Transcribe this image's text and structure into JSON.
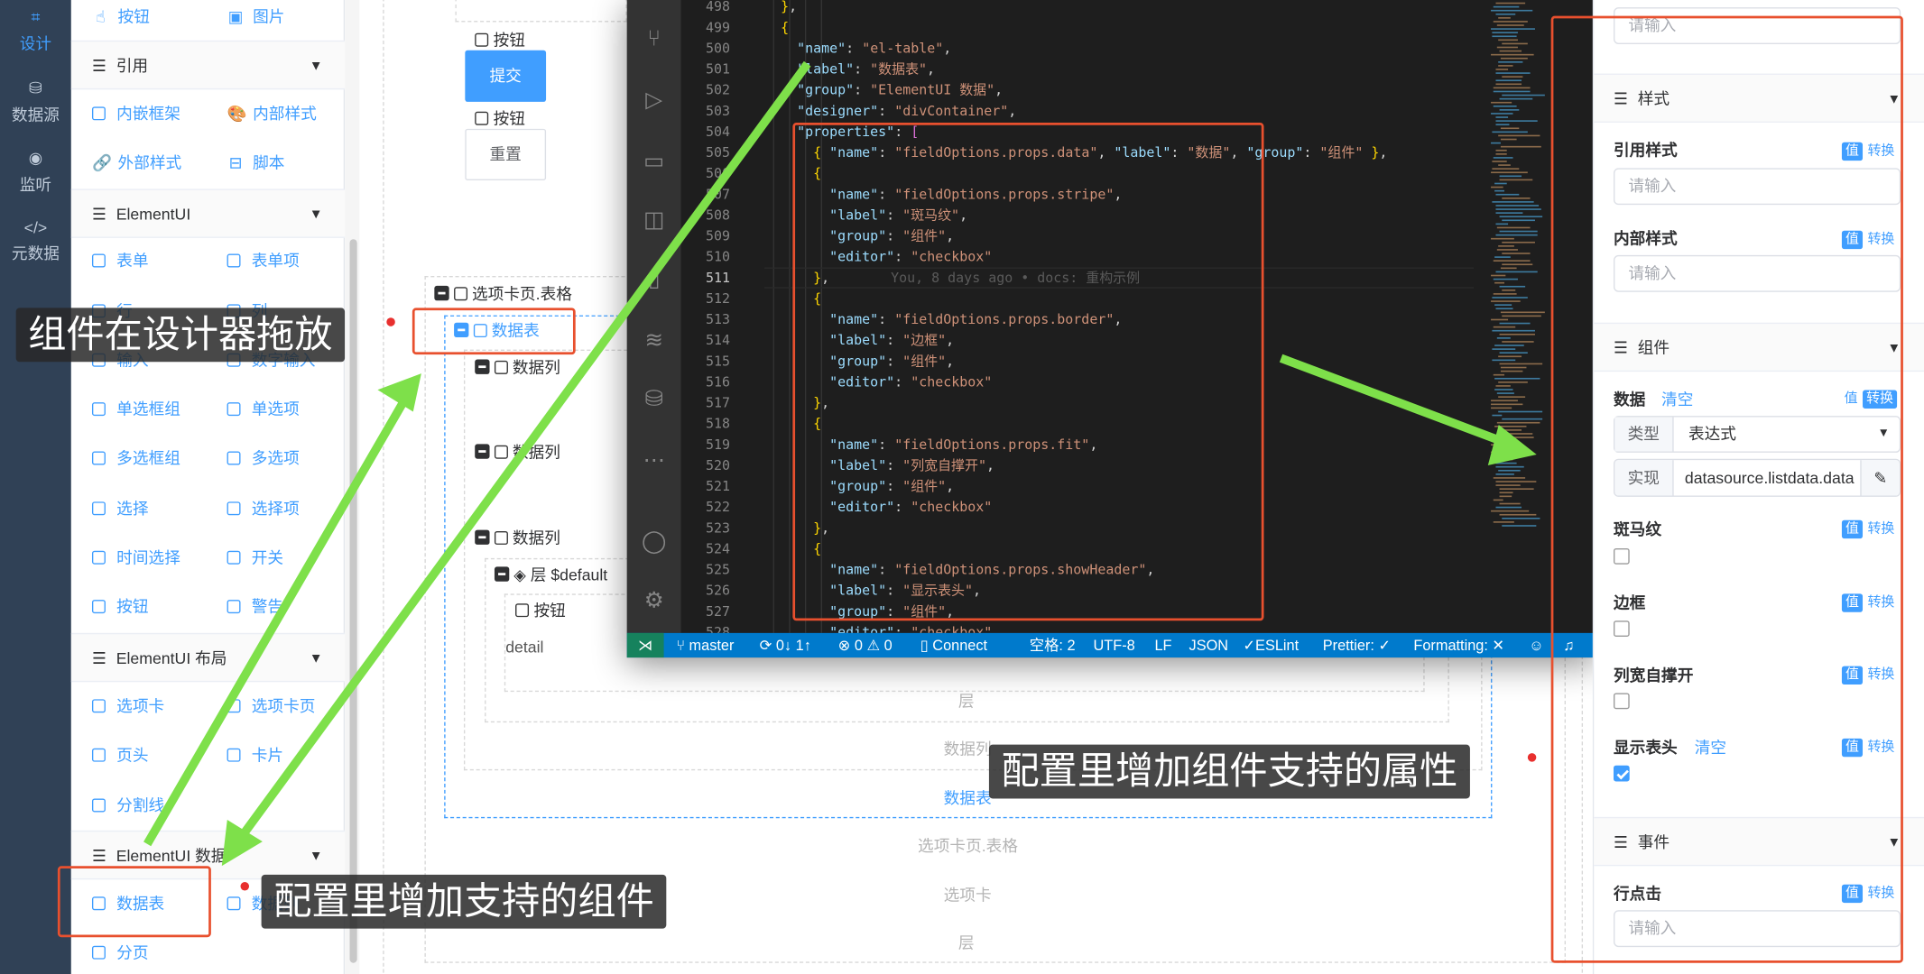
{
  "nav": {
    "items": [
      {
        "label": "设计",
        "icon": "design-icon",
        "glyph": "⌗",
        "active": true
      },
      {
        "label": "数据源",
        "icon": "database-icon",
        "glyph": "⛁",
        "active": false
      },
      {
        "label": "监听",
        "icon": "listen-icon",
        "glyph": "◉",
        "active": false
      },
      {
        "label": "元数据",
        "icon": "code-icon",
        "glyph": "</>",
        "active": false
      }
    ]
  },
  "palette": {
    "groups": [
      {
        "label": "引用"
      },
      {
        "label": "ElementUI"
      },
      {
        "label": "ElementUI 布局"
      },
      {
        "label": "ElementUI 数据"
      }
    ],
    "items": {
      "button_top": "按钮",
      "image": "图片",
      "iframe": "内嵌框架",
      "inner_style": "内部样式",
      "outer_style": "外部样式",
      "script": "脚本",
      "form": "表单",
      "form_item": "表单项",
      "row": "行",
      "col": "列",
      "input": "输入",
      "number_input": "数字输入",
      "radio_group": "单选框组",
      "radio": "单选项",
      "checkbox_group": "多选框组",
      "checkbox": "多选项",
      "select": "选择",
      "option": "选择项",
      "time_picker": "时间选择",
      "switch": "开关",
      "button": "按钮",
      "alert": "警告",
      "tabs": "选项卡",
      "tab_pane": "选项卡页",
      "page_header": "页头",
      "card": "卡片",
      "divider": "分割线",
      "data_table": "数据表",
      "data_col": "数据列",
      "pagination": "分页"
    }
  },
  "canvas": {
    "button_label": "按钮",
    "submit": "提交",
    "reset": "重置",
    "tab_pane_table": "选项卡页.表格",
    "data_table": "数据表",
    "data_col": "数据列",
    "layer": "层 $default",
    "detail": "detail",
    "footer_layer": "层",
    "footer_data_col": "数据列",
    "footer_data_table": "数据表",
    "footer_tab_pane": "选项卡页.表格",
    "footer_tabs": "选项卡",
    "footer_layer2": "层"
  },
  "editor": {
    "lines": [
      {
        "n": 498,
        "code": "  },"
      },
      {
        "n": 499,
        "code": "  {"
      },
      {
        "n": 500,
        "code": "    \"name\": \"el-table\","
      },
      {
        "n": 501,
        "code": "    \"label\": \"数据表\","
      },
      {
        "n": 502,
        "code": "    \"group\": \"ElementUI 数据\","
      },
      {
        "n": 503,
        "code": "    \"designer\": \"divContainer\","
      },
      {
        "n": 504,
        "code": "    \"properties\": ["
      },
      {
        "n": 505,
        "code": "      { \"name\": \"fieldOptions.props.data\", \"label\": \"数据\", \"group\": \"组件\" },"
      },
      {
        "n": 506,
        "code": "      {"
      },
      {
        "n": 507,
        "code": "        \"name\": \"fieldOptions.props.stripe\","
      },
      {
        "n": 508,
        "code": "        \"label\": \"斑马纹\","
      },
      {
        "n": 509,
        "code": "        \"group\": \"组件\","
      },
      {
        "n": 510,
        "code": "        \"editor\": \"checkbox\""
      },
      {
        "n": 511,
        "code": "      },"
      },
      {
        "n": 512,
        "code": "      {"
      },
      {
        "n": 513,
        "code": "        \"name\": \"fieldOptions.props.border\","
      },
      {
        "n": 514,
        "code": "        \"label\": \"边框\","
      },
      {
        "n": 515,
        "code": "        \"group\": \"组件\","
      },
      {
        "n": 516,
        "code": "        \"editor\": \"checkbox\""
      },
      {
        "n": 517,
        "code": "      },"
      },
      {
        "n": 518,
        "code": "      {"
      },
      {
        "n": 519,
        "code": "        \"name\": \"fieldOptions.props.fit\","
      },
      {
        "n": 520,
        "code": "        \"label\": \"列宽自撑开\","
      },
      {
        "n": 521,
        "code": "        \"group\": \"组件\","
      },
      {
        "n": 522,
        "code": "        \"editor\": \"checkbox\""
      },
      {
        "n": 523,
        "code": "      },"
      },
      {
        "n": 524,
        "code": "      {"
      },
      {
        "n": 525,
        "code": "        \"name\": \"fieldOptions.props.showHeader\","
      },
      {
        "n": 526,
        "code": "        \"label\": \"显示表头\","
      },
      {
        "n": 527,
        "code": "        \"group\": \"组件\","
      },
      {
        "n": 528,
        "code": "        \"editor\": \"checkbox\","
      }
    ],
    "blame": "You, 8 days ago • docs: 重构示例",
    "status": {
      "branch": "master",
      "sync": "0↓ 1↑",
      "problems": "0 ⚠ 0",
      "connect": "Connect",
      "spaces": "空格: 2",
      "encoding": "UTF-8",
      "eol": "LF",
      "language": "JSON",
      "eslint": "ESLint",
      "prettier": "Prettier: ✓",
      "formatting": "Formatting: ✕"
    }
  },
  "props": {
    "top_placeholder": "请输入",
    "style_section": "样式",
    "ref_style_label": "引用样式",
    "inner_style_label": "内部样式",
    "component_section": "组件",
    "data_label": "数据",
    "clear": "清空",
    "type_label": "类型",
    "type_value": "表达式",
    "impl_label": "实现",
    "impl_value": "datasource.listdata.data",
    "stripe_label": "斑马纹",
    "border_label": "边框",
    "fit_label": "列宽自撑开",
    "show_header_label": "显示表头",
    "event_section": "事件",
    "row_click_label": "行点击",
    "placeholder": "请输入",
    "value_tag": "值",
    "convert": "转换"
  },
  "annotations": {
    "drag": "组件在设计器拖放",
    "add_props": "配置里增加组件支持的属性",
    "add_component": "配置里增加支持的组件"
  },
  "colors": {
    "accent": "#409eff",
    "nav_bg": "#304156",
    "annotation_red": "#e8502e",
    "arrow_green": "#7ee04a",
    "statusbar": "#007acc"
  }
}
